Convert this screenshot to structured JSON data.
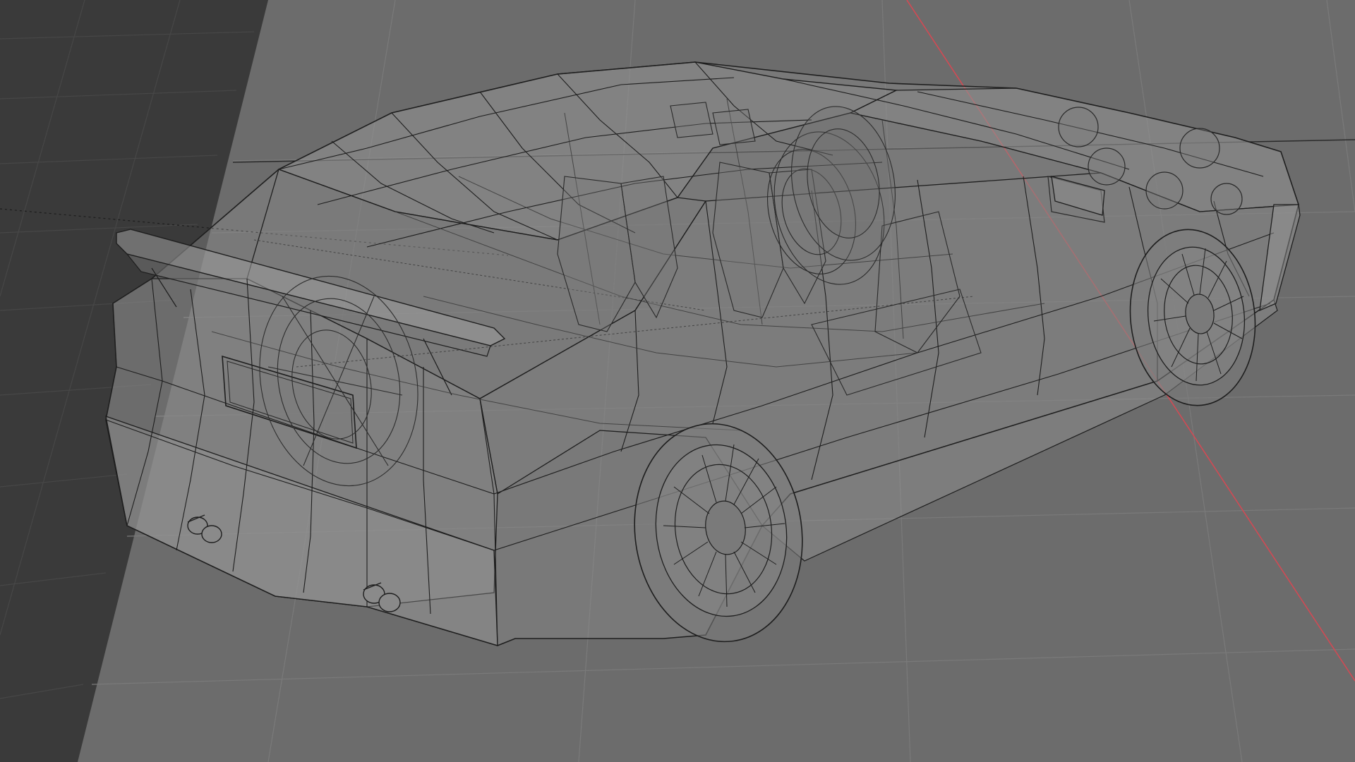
{
  "app": {
    "kind": "3d-viewport",
    "shading_mode": "x-ray wireframe",
    "object_label": "",
    "header_text": ""
  },
  "colors": {
    "background": "#6c6c6c",
    "dark_panel": "#393939",
    "grid_line": "#7b7b7b",
    "grid_line_dark": "#454545",
    "x_axis": "#d14a54",
    "floor_line": "#2a2a2a",
    "wire": "#1e1e1e",
    "wire_faint": "#3c3c3c",
    "surface": "#8a8a8a"
  },
  "icons": [
    "wheel-icon",
    "exhaust-pipe-icon",
    "seat-icon",
    "headlight-icon"
  ]
}
